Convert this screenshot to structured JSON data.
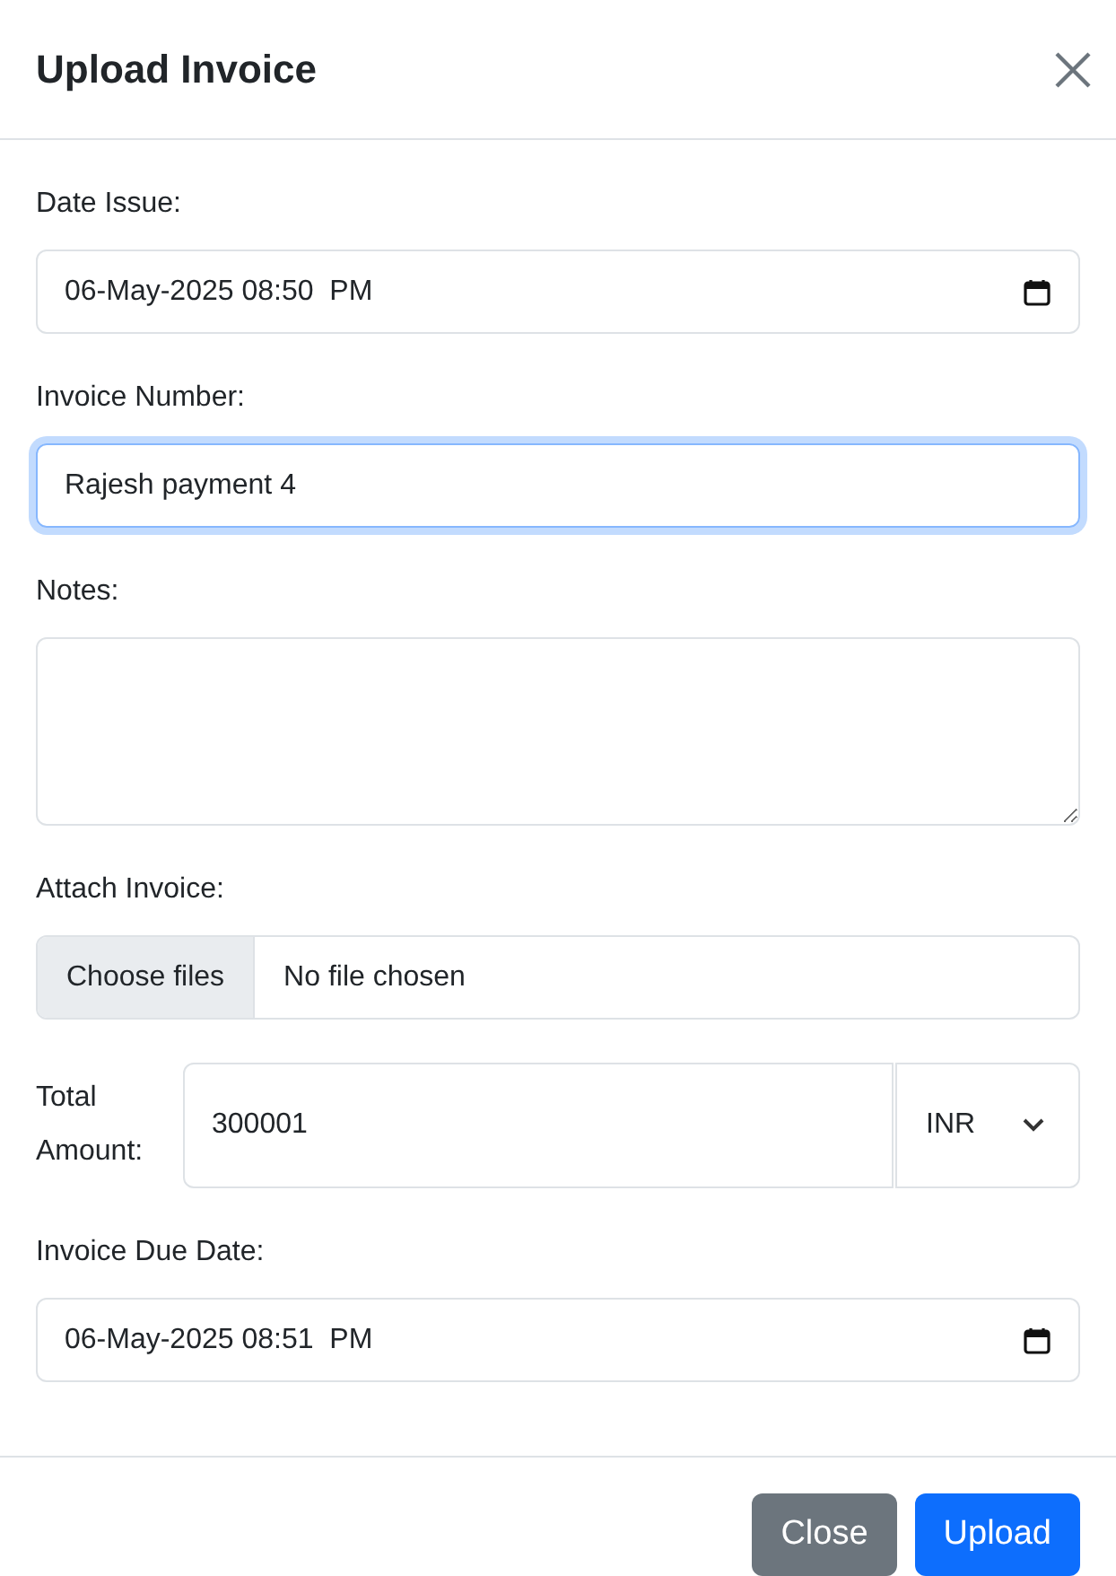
{
  "modal": {
    "title": "Upload Invoice"
  },
  "fields": [
    {
      "kind": "datetime",
      "label": "Date Issue:",
      "value": "06-May-2025 08:50  PM"
    },
    {
      "kind": "text",
      "label": "Invoice Number:",
      "value": "Rajesh payment 4",
      "focused": true
    },
    {
      "kind": "textarea",
      "label": "Notes:"
    },
    {
      "kind": "file",
      "label": "Attach Invoice:",
      "button": "Choose files",
      "value": "No file chosen"
    },
    {
      "kind": "amount",
      "label": "Total Amount:",
      "value": "300001",
      "currency": "INR"
    },
    {
      "kind": "datetime",
      "label": "Invoice Due Date:",
      "value": "06-May-2025 08:51  PM"
    }
  ],
  "buttons": [
    {
      "label": "Close",
      "kind": "secondary"
    },
    {
      "label": "Upload",
      "kind": "primary"
    }
  ]
}
